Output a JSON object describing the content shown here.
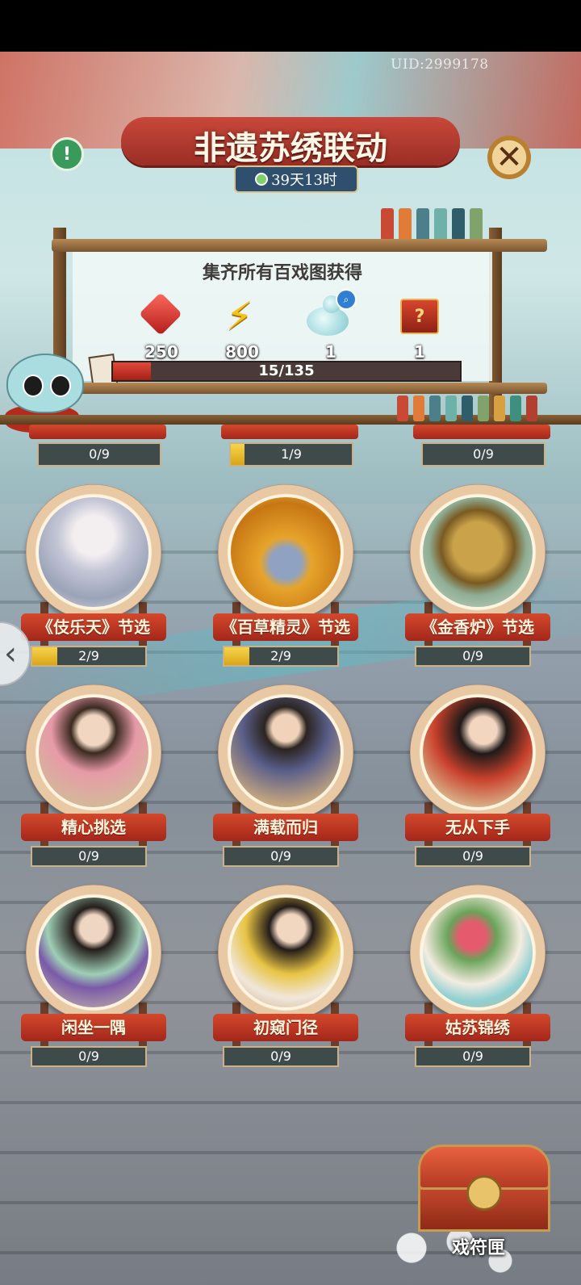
{
  "header": {
    "uid": "UID:2999178",
    "title": "非遗苏绣联动",
    "timer": "39天13时"
  },
  "panel": {
    "subtitle": "集齐所有百戏图获得",
    "rewards": [
      {
        "icon": "red-gem-icon",
        "count": "250"
      },
      {
        "icon": "lightning-icon",
        "count": "800"
      },
      {
        "icon": "gourd-icon",
        "count": "1"
      },
      {
        "icon": "mystery-box-icon",
        "count": "1"
      }
    ],
    "progress": {
      "text": "15/135",
      "fraction": 0.11
    }
  },
  "top_row": [
    {
      "progress": "0/9",
      "fraction": 0
    },
    {
      "progress": "1/9",
      "fraction": 0.11
    },
    {
      "progress": "0/9",
      "fraction": 0
    }
  ],
  "cards": [
    {
      "label": "《伎乐天》节选",
      "progress": "2/9",
      "fraction": 0.22
    },
    {
      "label": "《百草精灵》节选",
      "progress": "2/9",
      "fraction": 0.22
    },
    {
      "label": "《金香炉》节选",
      "progress": "0/9",
      "fraction": 0
    },
    {
      "label": "精心挑选",
      "progress": "0/9",
      "fraction": 0
    },
    {
      "label": "满载而归",
      "progress": "0/9",
      "fraction": 0
    },
    {
      "label": "无从下手",
      "progress": "0/9",
      "fraction": 0
    },
    {
      "label": "闲坐一隅",
      "progress": "0/9",
      "fraction": 0
    },
    {
      "label": "初窥门径",
      "progress": "0/9",
      "fraction": 0
    },
    {
      "label": "姑苏锦绣",
      "progress": "0/9",
      "fraction": 0
    }
  ],
  "chest": {
    "label": "戏符匣"
  },
  "colors": {
    "accent_red": "#c8483a",
    "progress_yellow": "#f7d44a",
    "frame_brown": "#8a4b33"
  }
}
